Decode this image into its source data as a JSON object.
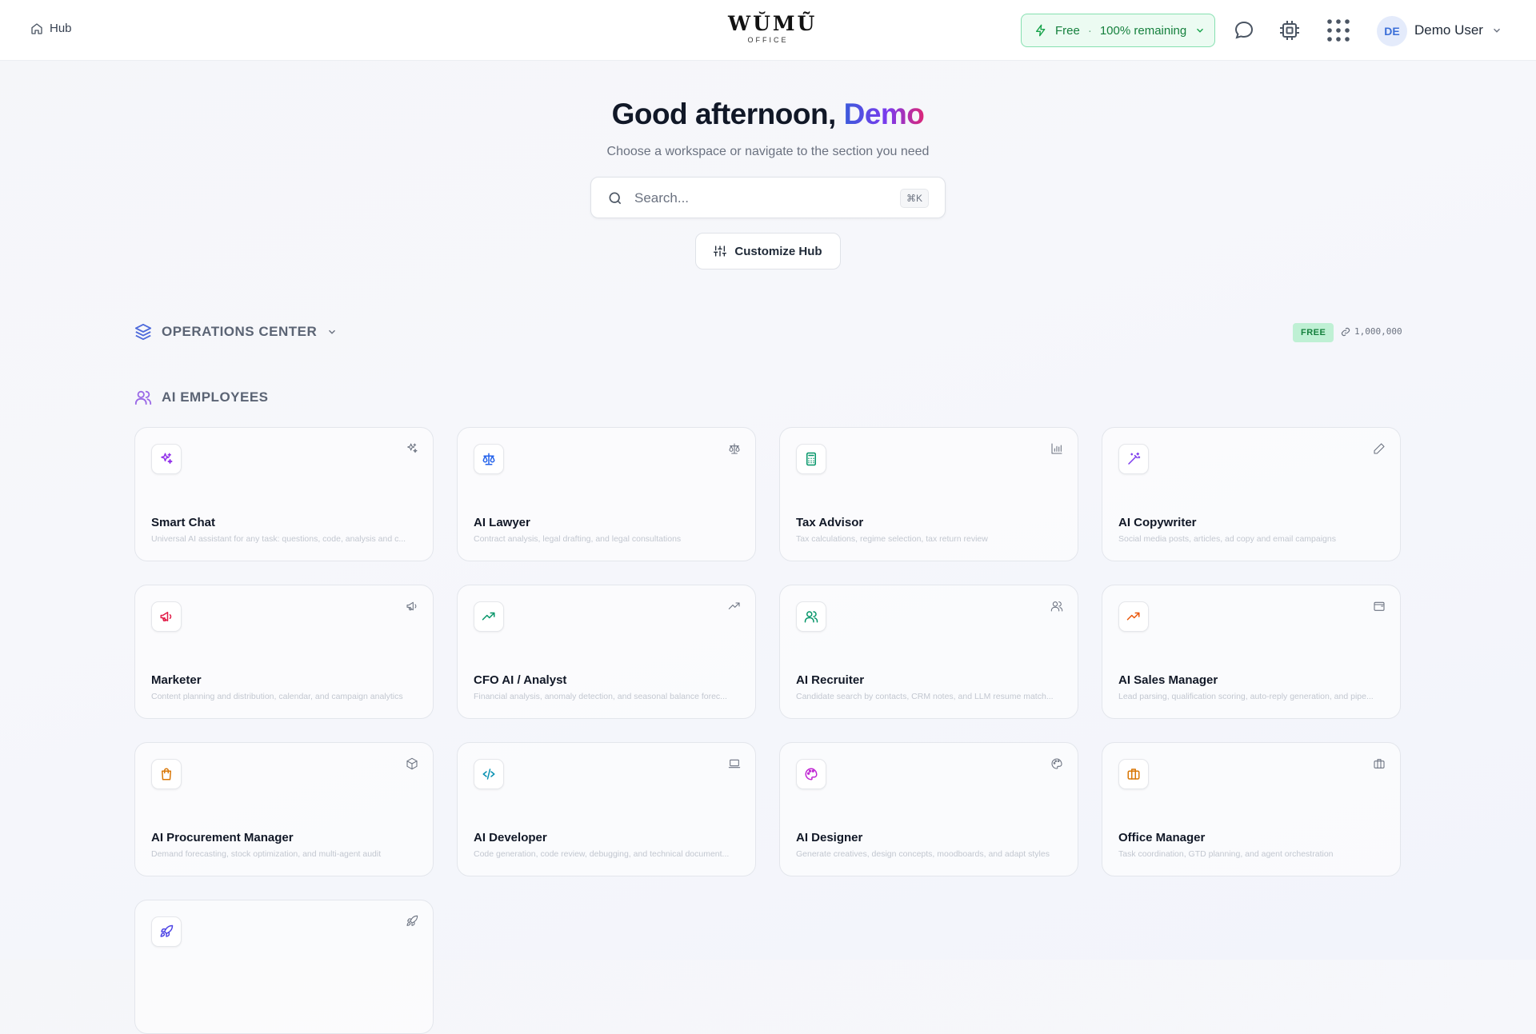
{
  "header": {
    "hub_label": "Hub",
    "logo_main": "WŬMŨ",
    "logo_sub": "OFFICE",
    "plan": {
      "name": "Free",
      "separator": "·",
      "remaining": "100% remaining"
    },
    "user": {
      "initials": "DE",
      "name": "Demo User"
    }
  },
  "hero": {
    "greeting": "Good afternoon,",
    "greeting_name": "Demo",
    "subtitle": "Choose a workspace or navigate to the section you need",
    "search_placeholder": "Search...",
    "search_shortcut": "⌘K",
    "customize_label": "Customize Hub"
  },
  "operations": {
    "title": "OPERATIONS CENTER",
    "badge": "FREE",
    "tokens": "1,000,000"
  },
  "employees": {
    "title": "AI EMPLOYEES",
    "cards": [
      {
        "title": "Smart Chat",
        "desc": "Universal AI assistant for any task: questions, code, analysis and c...",
        "icon": "sparkles-icon",
        "color": "#9333ea"
      },
      {
        "title": "AI Lawyer",
        "desc": "Contract analysis, legal drafting, and legal consultations",
        "icon": "scale-icon",
        "color": "#2563eb"
      },
      {
        "title": "Tax Advisor",
        "desc": "Tax calculations, regime selection, tax return review",
        "icon": "calculator-icon",
        "color": "#059669"
      },
      {
        "title": "AI Copywriter",
        "desc": "Social media posts, articles, ad copy and email campaigns",
        "icon": "wand-icon",
        "color": "#7c3aed"
      },
      {
        "title": "Marketer",
        "desc": "Content planning and distribution, calendar, and campaign analytics",
        "icon": "megaphone-icon",
        "color": "#e11d48"
      },
      {
        "title": "CFO AI / Analyst",
        "desc": "Financial analysis, anomaly detection, and seasonal balance forec...",
        "icon": "trending-up-icon",
        "color": "#059669"
      },
      {
        "title": "AI Recruiter",
        "desc": "Candidate search by contacts, CRM notes, and LLM resume match...",
        "icon": "users-icon",
        "color": "#059669"
      },
      {
        "title": "AI Sales Manager",
        "desc": "Lead parsing, qualification scoring, auto-reply generation, and pipe...",
        "icon": "trending-up-icon",
        "color": "#ea580c"
      },
      {
        "title": "AI Procurement Manager",
        "desc": "Demand forecasting, stock optimization, and multi-agent audit",
        "icon": "shopping-bag-icon",
        "color": "#d97706"
      },
      {
        "title": "AI Developer",
        "desc": "Code generation, code review, debugging, and technical document...",
        "icon": "code-icon",
        "color": "#0891b2"
      },
      {
        "title": "AI Designer",
        "desc": "Generate creatives, design concepts, moodboards, and adapt styles",
        "icon": "palette-icon",
        "color": "#c026d3"
      },
      {
        "title": "Office Manager",
        "desc": "Task coordination, GTD planning, and agent orchestration",
        "icon": "briefcase-icon",
        "color": "#d97706"
      },
      {
        "title": "",
        "desc": "",
        "icon": "rocket-icon",
        "color": "#4f46e5"
      }
    ]
  }
}
